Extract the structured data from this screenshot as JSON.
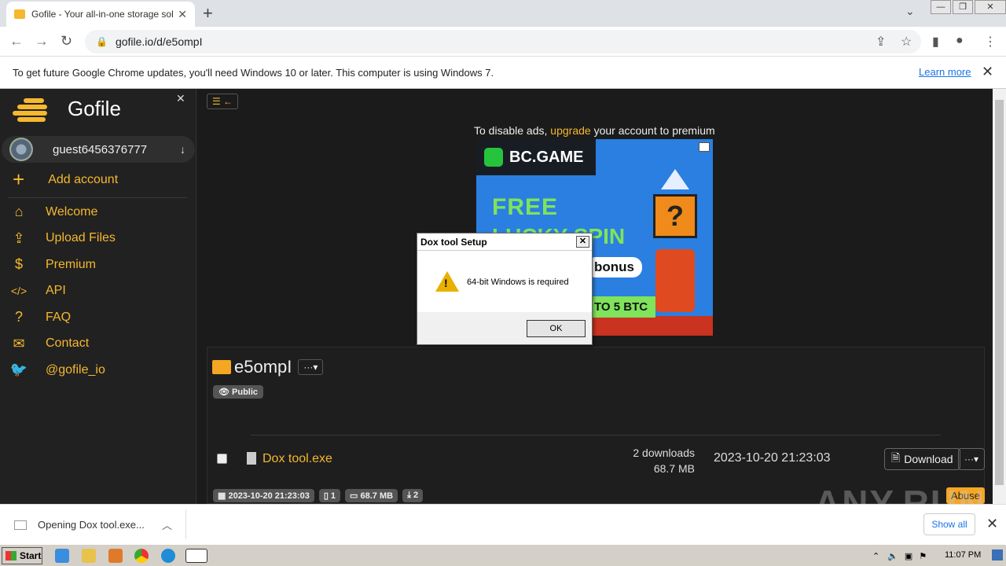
{
  "browser": {
    "tab_title": "Gofile - Your all-in-one storage solut",
    "url": "gofile.io/d/e5ompI",
    "new_tab": "+",
    "tab_close": "✕"
  },
  "infobar": {
    "message": "To get future Google Chrome updates, you'll need Windows 10 or later. This computer is using Windows 7.",
    "learn_more": "Learn more"
  },
  "sidebar": {
    "brand": "Gofile",
    "username": "guest6456376777",
    "add_account": "Add account",
    "items": [
      {
        "label": "Welcome",
        "icon": "home-icon",
        "glyph": "⌂"
      },
      {
        "label": "Upload Files",
        "icon": "upload-icon",
        "glyph": "⇪"
      },
      {
        "label": "Premium",
        "icon": "dollar-icon",
        "glyph": "$"
      },
      {
        "label": "API",
        "icon": "code-icon",
        "glyph": "</>"
      },
      {
        "label": "FAQ",
        "icon": "question-icon",
        "glyph": "?"
      },
      {
        "label": "Contact",
        "icon": "mail-icon",
        "glyph": "✉"
      },
      {
        "label": "@gofile_io",
        "icon": "twitter-icon",
        "glyph": "🐦"
      }
    ]
  },
  "ad": {
    "text_pre": "To disable ads, ",
    "text_link": "upgrade",
    "text_post": " your account to premium",
    "brand": "BC.GAME",
    "free": "FREE",
    "spin": "LUCKY SPIN",
    "bonus": "bonus",
    "btc": "TO 5 BTC",
    "qmark": "?"
  },
  "folder": {
    "name": "e5ompI",
    "visibility": "Public",
    "file": {
      "name": "Dox tool.exe",
      "downloads": "2 downloads",
      "size": "68.7 MB",
      "date": "2023-10-20 21:23:03",
      "download_label": "Download"
    },
    "stats": {
      "created": "2023-10-20 21:23:03",
      "count": "1",
      "size": "68.7 MB",
      "downloads": "2"
    },
    "abuse": "Abuse"
  },
  "dialog": {
    "title": "Dox tool Setup",
    "message": "64-bit Windows is required",
    "ok": "OK"
  },
  "downloadbar": {
    "item": "Opening Dox tool.exe...",
    "show_all": "Show all"
  },
  "taskbar": {
    "start": "Start",
    "clock": "11:07 PM"
  },
  "watermark": "ANY.RUN"
}
